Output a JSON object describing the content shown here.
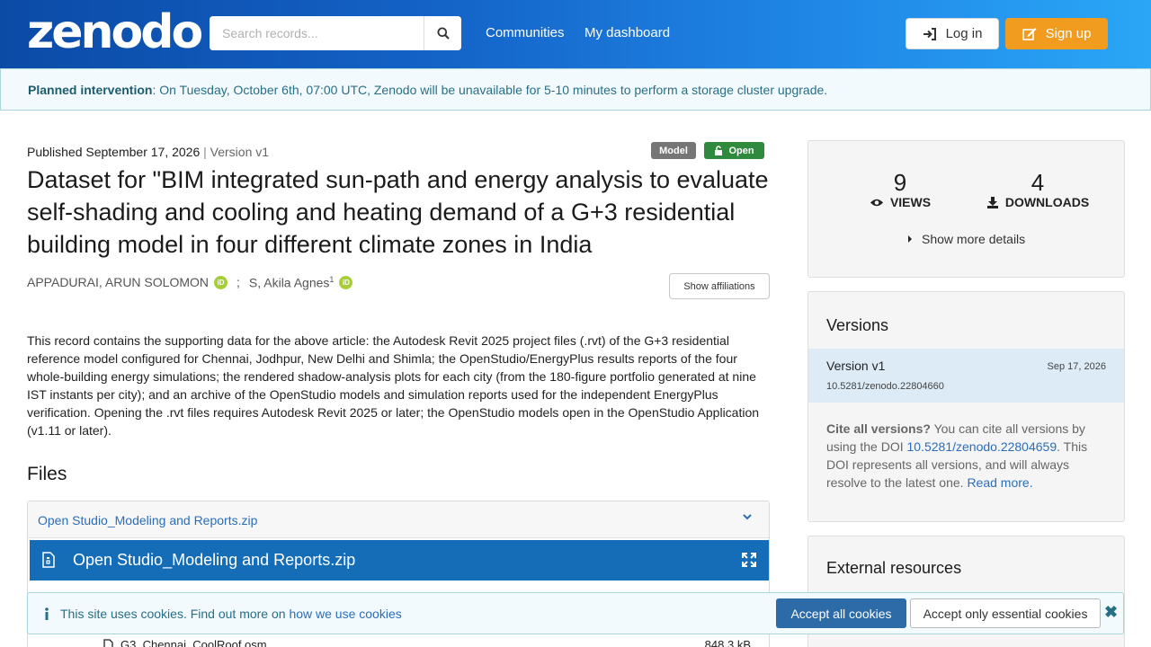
{
  "header": {
    "logo": "zenodo",
    "search_placeholder": "Search records...",
    "nav": [
      "Communities",
      "My dashboard"
    ],
    "login_label": "Log in",
    "signup_label": "Sign up"
  },
  "banner": {
    "title": "Planned intervention",
    "text": ": On Tuesday, October 6th, 07:00 UTC, Zenodo will be unavailable for 5-10 minutes to perform a storage cluster upgrade."
  },
  "record": {
    "published": "Published September 17, 2026",
    "version": "Version v1",
    "badge_type": "Model",
    "badge_access": "Open",
    "title": "Dataset for \"BIM integrated sun-path and energy analysis to evaluate self-shading and cooling and heating demand of a G+3 residential building model in four different climate zones in India",
    "authors": [
      {
        "name": "APPADURAI, ARUN SOLOMON",
        "sup": ""
      },
      {
        "name": "S, Akila Agnes",
        "sup": "1"
      }
    ],
    "show_affiliations": "Show affiliations",
    "description": "This record contains the supporting data for the above article: the Autodesk Revit 2025 project files (.rvt) of the G+3 residential reference model configured for Chennai, Jodhpur, New Delhi and Shimla; the OpenStudio/EnergyPlus results reports of the four whole-building energy simulations; the rendered shadow-analysis plots for each city (from the 180-figure portfolio generated at nine IST instants per city); and an archive of the OpenStudio models and simulation reports used for the independent EnergyPlus verification. Opening the .rvt files requires Autodesk Revit 2025 or later; the OpenStudio models open in the OpenStudio Application (v1.11 or later)."
  },
  "files": {
    "heading": "Files",
    "accordion_label": "Open Studio_Modeling and Reports.zip",
    "preview_label": "Open Studio_Modeling and Reports.zip",
    "rows": [
      {
        "name": "G3_Chennai_CoolRoof.osm",
        "size": "848.3 kB"
      }
    ]
  },
  "stats": {
    "views": "9",
    "views_label": "VIEWS",
    "downloads": "4",
    "downloads_label": "DOWNLOADS",
    "more_details": "Show more details"
  },
  "versions": {
    "heading": "Versions",
    "active": {
      "name": "Version v1",
      "date": "Sep 17, 2026",
      "doi": "10.5281/zenodo.22804660"
    },
    "cite_bold": "Cite all versions?",
    "cite_text_1": " You can cite all versions by using the DOI ",
    "cite_doi": "10.5281/zenodo.22804659",
    "cite_text_2": ". This DOI represents all versions, and will always resolve to the latest one. ",
    "read_more": "Read more."
  },
  "external": {
    "heading": "External resources"
  },
  "cookies": {
    "text": "This site uses cookies. Find out more on ",
    "link": "how we use cookies",
    "accept_all": "Accept all cookies",
    "accept_essential": "Accept only essential cookies"
  }
}
